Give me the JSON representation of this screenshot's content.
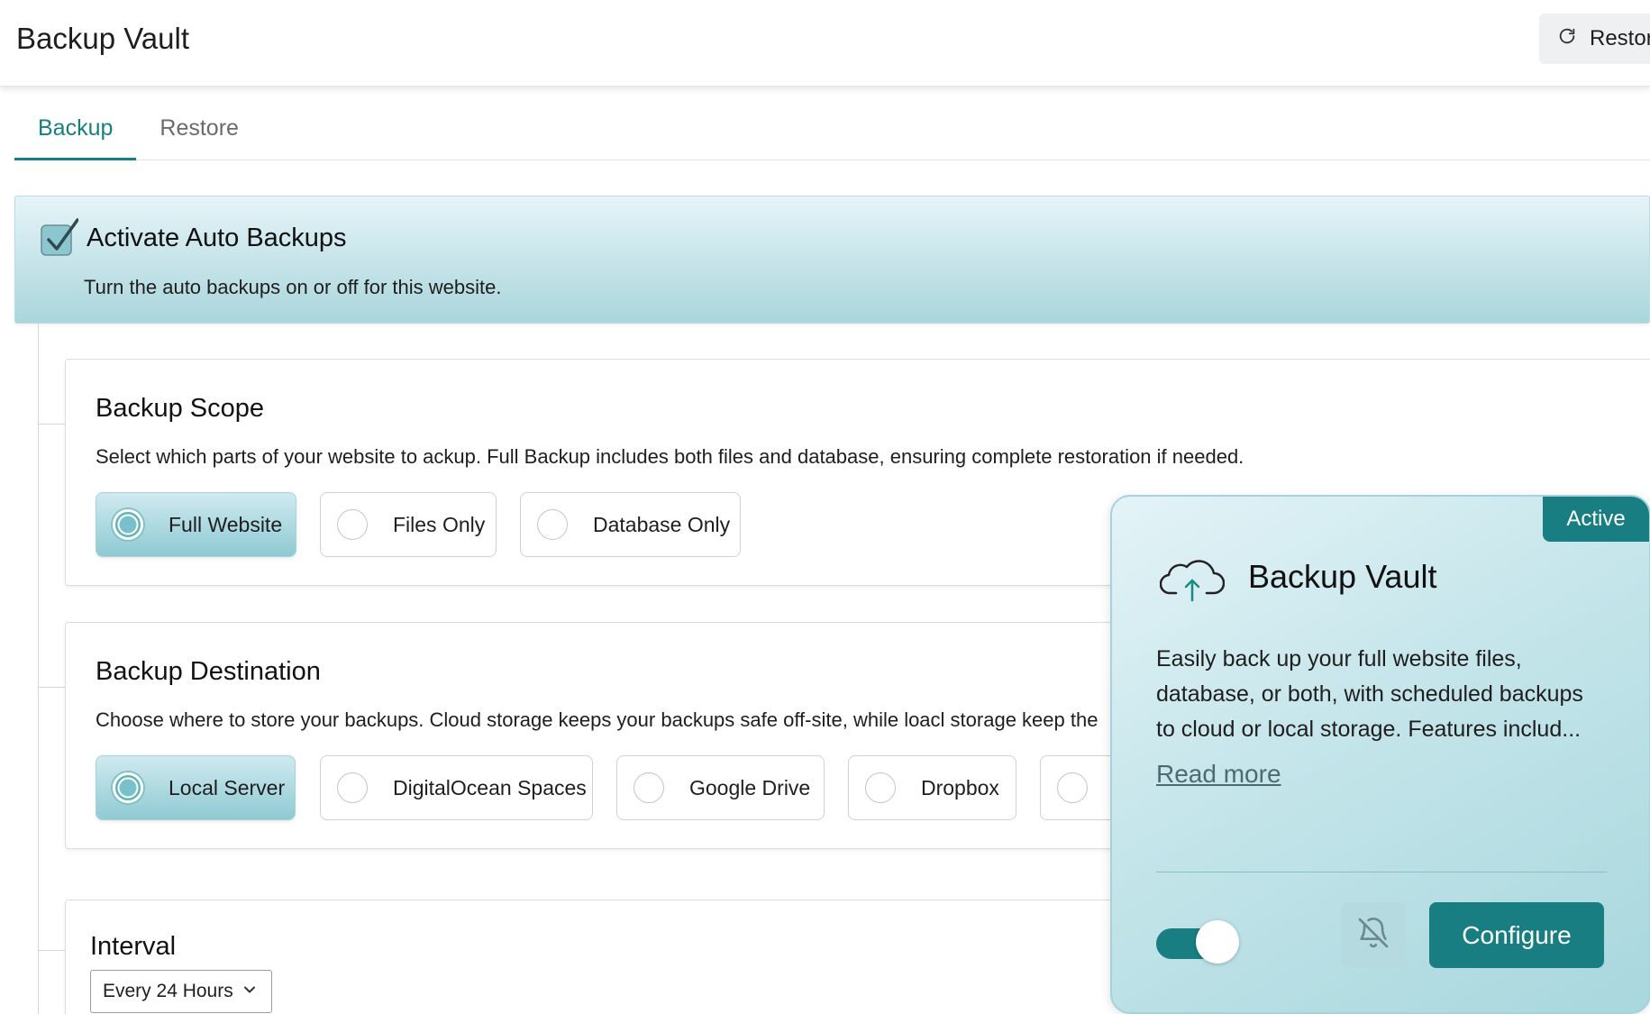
{
  "app": {
    "title": "Backup Vault",
    "header_button": {
      "label": "Restore",
      "icon": "refresh-icon"
    }
  },
  "tabs": [
    {
      "label": "Backup",
      "active": true
    },
    {
      "label": "Restore",
      "active": false
    }
  ],
  "activation": {
    "checked": true,
    "title": "Activate Auto Backups",
    "description": "Turn the auto backups on or off for this website."
  },
  "scope": {
    "title": "Backup Scope",
    "description": "Select which parts of your website to ackup. Full Backup includes both files and database, ensuring complete restoration if needed.",
    "options": [
      {
        "label": "Full Website",
        "selected": true
      },
      {
        "label": "Files Only",
        "selected": false
      },
      {
        "label": "Database Only",
        "selected": false
      }
    ]
  },
  "destination": {
    "title": "Backup Destination",
    "description": "Choose where to store your backups. Cloud storage keeps your backups safe off-site, while loacl storage keep the",
    "options": [
      {
        "label": "Local Server",
        "selected": true
      },
      {
        "label": "DigitalOcean Spaces",
        "selected": false
      },
      {
        "label": "Google Drive",
        "selected": false
      },
      {
        "label": "Dropbox",
        "selected": false
      },
      {
        "label": "",
        "selected": false
      }
    ]
  },
  "interval": {
    "title": "Interval",
    "selected": "Every 24 Hours"
  },
  "plugin_card": {
    "badge": "Active",
    "icon": "cloud-upload-icon",
    "title": "Backup Vault",
    "description": "Easily back up your full website files, database, or both, with scheduled backups to cloud or local storage. Features includ...",
    "read_more": "Read more",
    "enabled": true,
    "notifications_icon": "bell-off-icon",
    "configure_label": "Configure"
  },
  "colors": {
    "accent": "#187e82",
    "banner_gradient_top": "#e6f4f8",
    "banner_gradient_bottom": "#a9d6dc",
    "card_gradient": "#c4e5ea"
  }
}
